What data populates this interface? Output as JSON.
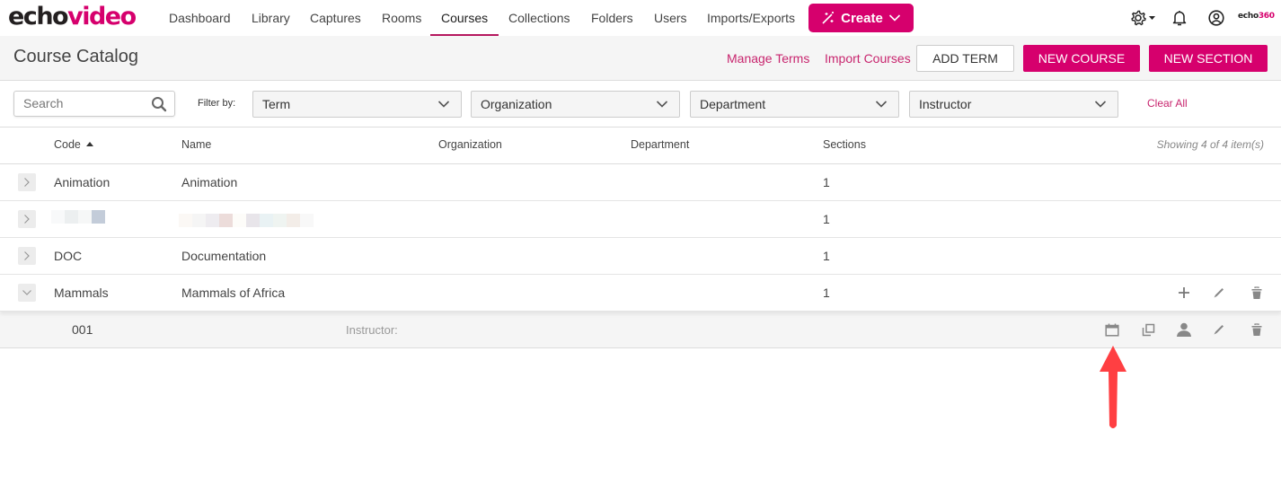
{
  "brand": {
    "logo_part1": "echo",
    "logo_part2": "video",
    "corner_logo_part1": "echo",
    "corner_logo_part2": "360",
    "accent": "#d6006d"
  },
  "nav": {
    "items": [
      {
        "label": "Dashboard"
      },
      {
        "label": "Library"
      },
      {
        "label": "Captures"
      },
      {
        "label": "Rooms"
      },
      {
        "label": "Courses",
        "active": true
      },
      {
        "label": "Collections"
      },
      {
        "label": "Folders"
      },
      {
        "label": "Users"
      },
      {
        "label": "Imports/Exports"
      }
    ],
    "create_label": "Create",
    "icons": [
      "gear-icon",
      "bell-icon",
      "user-circle-icon"
    ]
  },
  "header": {
    "title": "Course Catalog",
    "manage_terms": "Manage Terms",
    "import_courses": "Import Courses",
    "add_term": "ADD TERM",
    "new_course": "NEW COURSE",
    "new_section": "NEW SECTION"
  },
  "filters": {
    "search_placeholder": "Search",
    "filter_by_label": "Filter by:",
    "term": "Term",
    "organization": "Organization",
    "department": "Department",
    "instructor": "Instructor",
    "clear_all": "Clear All"
  },
  "table": {
    "columns": {
      "code": "Code",
      "name": "Name",
      "organization": "Organization",
      "department": "Department",
      "sections": "Sections"
    },
    "sort": {
      "column": "Code",
      "direction": "ascending"
    },
    "showing": "Showing 4 of 4 item(s)",
    "rows": [
      {
        "code": "Animation",
        "name": "Animation",
        "organization": "",
        "department": "",
        "sections": "1",
        "expanded": false
      },
      {
        "code": "[redacted]",
        "name": "[redacted]",
        "organization": "",
        "department": "",
        "sections": "1",
        "expanded": false
      },
      {
        "code": "DOC",
        "name": "Documentation",
        "organization": "",
        "department": "",
        "sections": "1",
        "expanded": false
      },
      {
        "code": "Mammals",
        "name": "Mammals of Africa",
        "organization": "",
        "department": "",
        "sections": "1",
        "expanded": true
      }
    ],
    "course_actions": [
      "add-section",
      "edit",
      "delete"
    ],
    "section": {
      "code": "001",
      "instructor_label": "Instructor:",
      "instructor_value": ""
    },
    "section_actions": [
      "schedule",
      "copy",
      "assign-instructor",
      "edit",
      "delete"
    ]
  },
  "annotation": {
    "type": "arrow",
    "color": "#ff3b3b",
    "points_to": "schedule-icon"
  }
}
